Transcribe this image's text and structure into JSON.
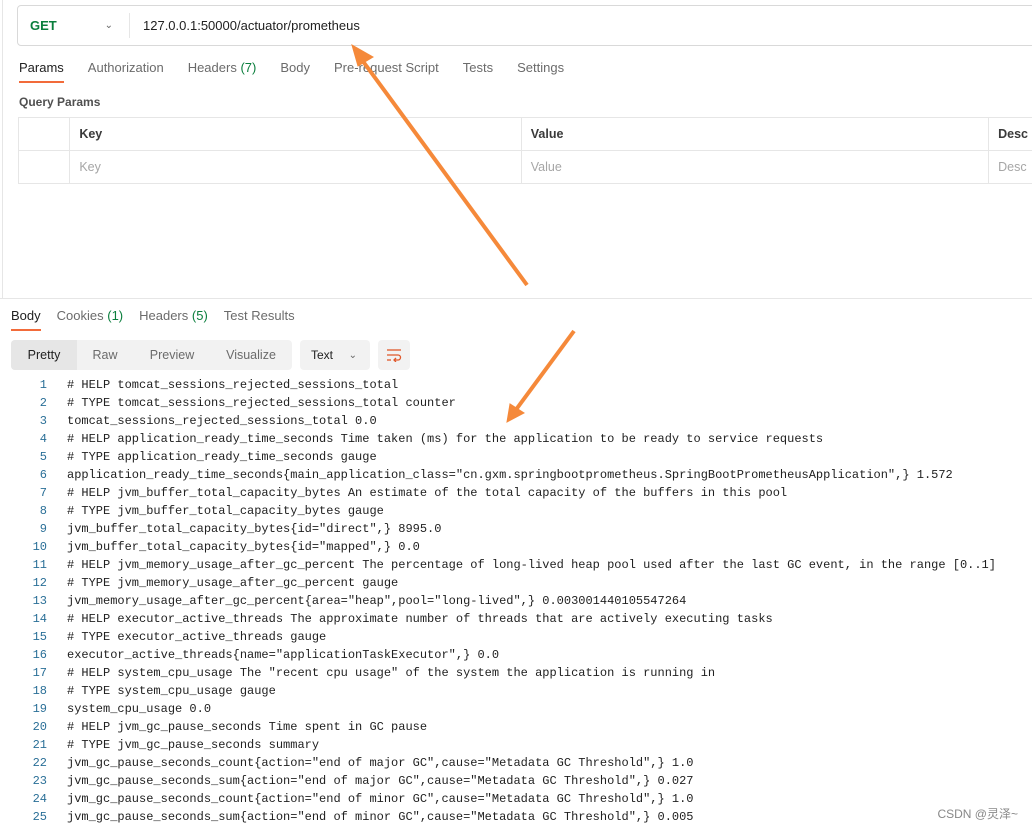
{
  "request": {
    "method": "GET",
    "url": "127.0.0.1:50000/actuator/prometheus"
  },
  "request_tabs": [
    {
      "label": "Params",
      "active": true
    },
    {
      "label": "Authorization"
    },
    {
      "label": "Headers",
      "count": "(7)"
    },
    {
      "label": "Body"
    },
    {
      "label": "Pre-request Script"
    },
    {
      "label": "Tests"
    },
    {
      "label": "Settings"
    }
  ],
  "query_params": {
    "title": "Query Params",
    "headers": [
      "Key",
      "Value",
      "Desc"
    ],
    "placeholders": [
      "Key",
      "Value",
      "Desc"
    ]
  },
  "response_tabs": [
    {
      "label": "Body",
      "active": true
    },
    {
      "label": "Cookies",
      "count": "(1)"
    },
    {
      "label": "Headers",
      "count": "(5)"
    },
    {
      "label": "Test Results"
    }
  ],
  "view_modes": [
    "Pretty",
    "Raw",
    "Preview",
    "Visualize"
  ],
  "format": "Text",
  "icons": {
    "format_chevron": "chevron-down-icon",
    "wrap": "wrap-lines-icon"
  },
  "accent_color": "#f26b3a",
  "arrow_color": "#f5893a",
  "lines": [
    "# HELP tomcat_sessions_rejected_sessions_total",
    "# TYPE tomcat_sessions_rejected_sessions_total counter",
    "tomcat_sessions_rejected_sessions_total 0.0",
    "# HELP application_ready_time_seconds Time taken (ms) for the application to be ready to service requests",
    "# TYPE application_ready_time_seconds gauge",
    "application_ready_time_seconds{main_application_class=\"cn.gxm.springbootprometheus.SpringBootPrometheusApplication\",} 1.572",
    "# HELP jvm_buffer_total_capacity_bytes An estimate of the total capacity of the buffers in this pool",
    "# TYPE jvm_buffer_total_capacity_bytes gauge",
    "jvm_buffer_total_capacity_bytes{id=\"direct\",} 8995.0",
    "jvm_buffer_total_capacity_bytes{id=\"mapped\",} 0.0",
    "# HELP jvm_memory_usage_after_gc_percent The percentage of long-lived heap pool used after the last GC event, in the range [0..1]",
    "# TYPE jvm_memory_usage_after_gc_percent gauge",
    "jvm_memory_usage_after_gc_percent{area=\"heap\",pool=\"long-lived\",} 0.003001440105547264",
    "# HELP executor_active_threads The approximate number of threads that are actively executing tasks",
    "# TYPE executor_active_threads gauge",
    "executor_active_threads{name=\"applicationTaskExecutor\",} 0.0",
    "# HELP system_cpu_usage The \"recent cpu usage\" of the system the application is running in",
    "# TYPE system_cpu_usage gauge",
    "system_cpu_usage 0.0",
    "# HELP jvm_gc_pause_seconds Time spent in GC pause",
    "# TYPE jvm_gc_pause_seconds summary",
    "jvm_gc_pause_seconds_count{action=\"end of major GC\",cause=\"Metadata GC Threshold\",} 1.0",
    "jvm_gc_pause_seconds_sum{action=\"end of major GC\",cause=\"Metadata GC Threshold\",} 0.027",
    "jvm_gc_pause_seconds_count{action=\"end of minor GC\",cause=\"Metadata GC Threshold\",} 1.0",
    "jvm_gc_pause_seconds_sum{action=\"end of minor GC\",cause=\"Metadata GC Threshold\",} 0.005"
  ],
  "watermark": "CSDN @灵泽~"
}
